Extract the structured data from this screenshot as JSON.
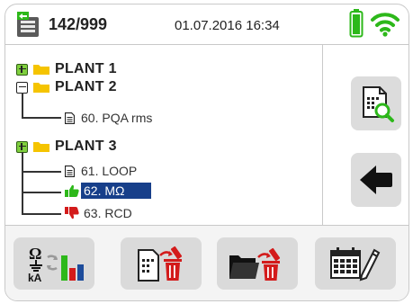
{
  "header": {
    "memory_counter": "142/999",
    "datetime": "01.07.2016 16:34",
    "battery_icon": "battery-full-icon",
    "signal_icon": "wifi-icon",
    "accent_green": "#2db81a"
  },
  "tree": {
    "plant1": {
      "label": "PLANT 1",
      "state": "collapsed"
    },
    "plant2": {
      "label": "PLANT 2",
      "state": "expanded",
      "items": [
        {
          "label": "60. PQA rms",
          "icon": "document-icon"
        }
      ]
    },
    "plant3": {
      "label": "PLANT 3",
      "state": "expanded",
      "items": [
        {
          "label": "61. LOOP",
          "icon": "document-icon"
        },
        {
          "label": "62. MΩ",
          "icon": "thumbs-up-icon",
          "selected": true
        },
        {
          "label": "63. RCD",
          "icon": "thumbs-down-icon"
        }
      ]
    },
    "selection_color": "#173f8a"
  },
  "side": {
    "view_icon": "document-search-icon",
    "back_icon": "arrow-left-icon"
  },
  "footer": {
    "buttons": [
      {
        "icon": "measurement-type-icon",
        "text": "kA"
      },
      {
        "icon": "delete-measurement-icon"
      },
      {
        "icon": "delete-folder-icon"
      },
      {
        "icon": "calendar-edit-icon"
      }
    ],
    "delete_color": "#d31b1b"
  }
}
